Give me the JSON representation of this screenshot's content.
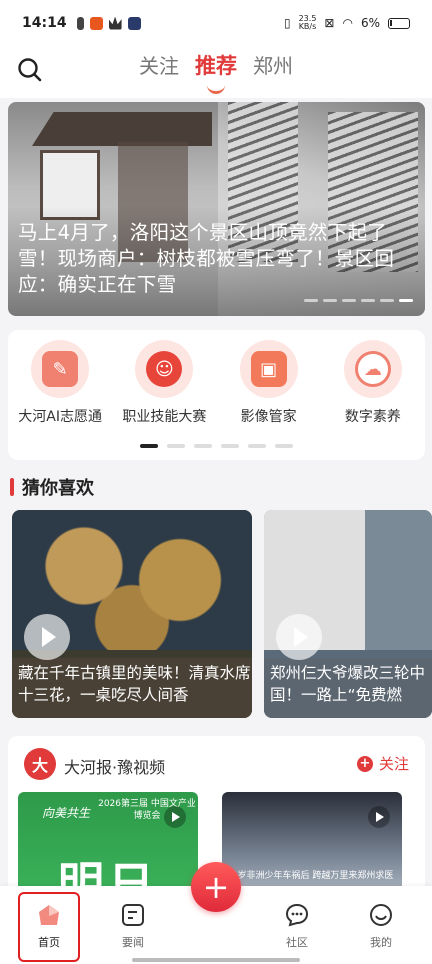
{
  "status_bar": {
    "time": "14:14",
    "net_speed": "23.5",
    "net_unit": "KB/s",
    "battery": "6%"
  },
  "top_nav": {
    "tabs": [
      {
        "label": "关注",
        "active": false
      },
      {
        "label": "推荐",
        "active": true
      },
      {
        "label": "郑州",
        "active": false
      }
    ]
  },
  "banner": {
    "title": "马上4月了，洛阳这个景区山顶竟然下起了雪！现场商户：树枝都被雪压弯了！景区回应：确实正在下雪"
  },
  "services": {
    "items": [
      {
        "label": "大河AI志愿通",
        "icon": "volunteer-icon"
      },
      {
        "label": "职业技能大赛",
        "icon": "mascot-icon"
      },
      {
        "label": "影像管家",
        "icon": "photo-icon"
      },
      {
        "label": "数字素养",
        "icon": "cloud-icon"
      }
    ],
    "page_count": 6,
    "active_page": 0
  },
  "guess": {
    "heading": "猜你喜欢",
    "cards": [
      {
        "title": "藏在千年古镇里的美味！清真水席十三花，一桌吃尽人间香"
      },
      {
        "title": "郑州仨大爷爆改三轮中国！一路上“免费燃"
      }
    ]
  },
  "channel": {
    "logo_text": "大",
    "name": "大河报·豫视频",
    "follow_label": "关注",
    "thumb1": {
      "script_title": "向美共生",
      "sub": "2026第三届 中国文产业博览会",
      "big": "明日"
    },
    "thumb2": {
      "caption": "14岁非洲少年车祸后 跨越万里来郑州求医"
    }
  },
  "bottom_nav": {
    "items": [
      {
        "label": "首页",
        "active": true
      },
      {
        "label": "要闻",
        "active": false
      },
      {
        "label": "社区",
        "active": false
      },
      {
        "label": "我的",
        "active": false
      }
    ],
    "fab": "+"
  }
}
